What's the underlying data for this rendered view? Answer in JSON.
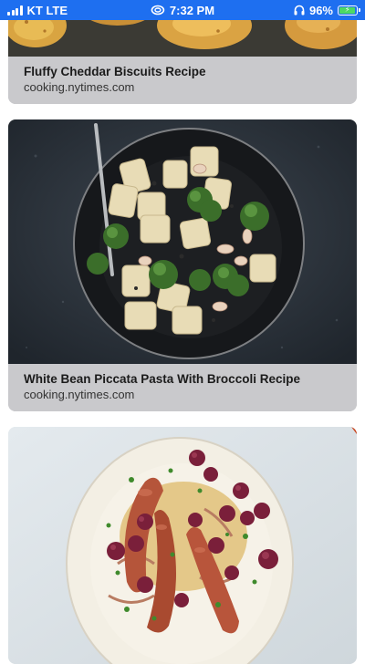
{
  "status_bar": {
    "carrier": "KT LTE",
    "time": "7:32 PM",
    "battery_percent": "96%",
    "background_color": "#1e6ff0",
    "battery_level": 0.96,
    "icons": [
      "signal-bars-icon",
      "alarm-icon",
      "headphones-icon",
      "battery-charging-icon"
    ]
  },
  "feed": {
    "cards": [
      {
        "title": "Fluffy Cheddar Biscuits Recipe",
        "source": "cooking.nytimes.com",
        "image": "cheddar-biscuits-photo"
      },
      {
        "title": "White Bean Piccata Pasta With Broccoli Recipe",
        "source": "cooking.nytimes.com",
        "image": "white-bean-pasta-broccoli-photo"
      },
      {
        "title": "",
        "source": "",
        "image": "sausage-grapes-plate-photo"
      }
    ]
  }
}
